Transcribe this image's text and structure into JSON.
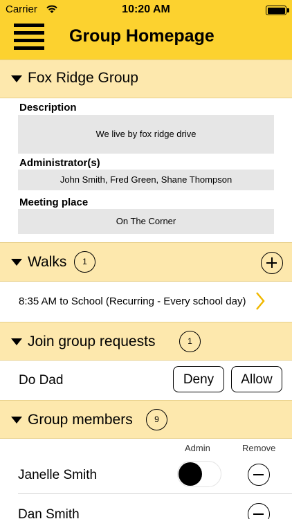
{
  "status_bar": {
    "carrier": "Carrier",
    "time": "10:20 AM"
  },
  "nav": {
    "title": "Group Homepage",
    "menu_icon": "hamburger-menu-icon"
  },
  "group": {
    "name": "Fox Ridge Group",
    "description_label": "Description",
    "description": "We live by fox ridge drive",
    "admins_label": "Administrator(s)",
    "admins": "John Smith, Fred Green, Shane Thompson",
    "meeting_label": "Meeting place",
    "meeting": "On The Corner"
  },
  "walks": {
    "title": "Walks",
    "count": "1",
    "add_icon": "plus-circle-icon",
    "items": [
      {
        "text": "8:35 AM to School (Recurring - Every school day)"
      }
    ]
  },
  "requests": {
    "title": "Join group requests",
    "count": "1",
    "items": [
      {
        "name": "Do Dad",
        "deny": "Deny",
        "allow": "Allow"
      }
    ]
  },
  "members": {
    "title": "Group members",
    "count": "9",
    "col_admin": "Admin",
    "col_remove": "Remove",
    "items": [
      {
        "name": "Janelle Smith",
        "admin": false
      },
      {
        "name": "Dan Smith",
        "admin": false
      }
    ]
  },
  "colors": {
    "accent": "#fcd22f",
    "section": "#fde8ad",
    "chevron": "#f0b800"
  }
}
